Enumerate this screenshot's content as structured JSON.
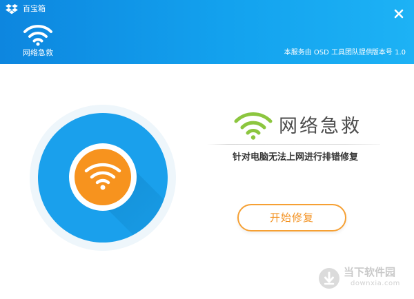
{
  "app": {
    "title": "百宝箱",
    "logo_icon": "dropbox-box-icon",
    "close_icon": "close-icon"
  },
  "tool": {
    "icon": "wifi-icon",
    "label": "网络急救"
  },
  "header": {
    "provider": "本服务由 OSD 工具团队提供",
    "version": "版本号 1.0"
  },
  "colors": {
    "header_blue": "#1598e8",
    "circle_blue": "#1aa0ec",
    "orange": "#f7931e",
    "wifi_green": "#8cc63f",
    "button_border": "#f6a033"
  },
  "feature": {
    "icon": "wifi-green-icon",
    "title": "网络急救",
    "description": "针对电脑无法上网进行排错修复"
  },
  "actions": {
    "start_repair": "开始修复"
  },
  "watermark": {
    "icon": "download-arrow-icon",
    "name": "当下软件园",
    "domain": "downxia.com"
  }
}
